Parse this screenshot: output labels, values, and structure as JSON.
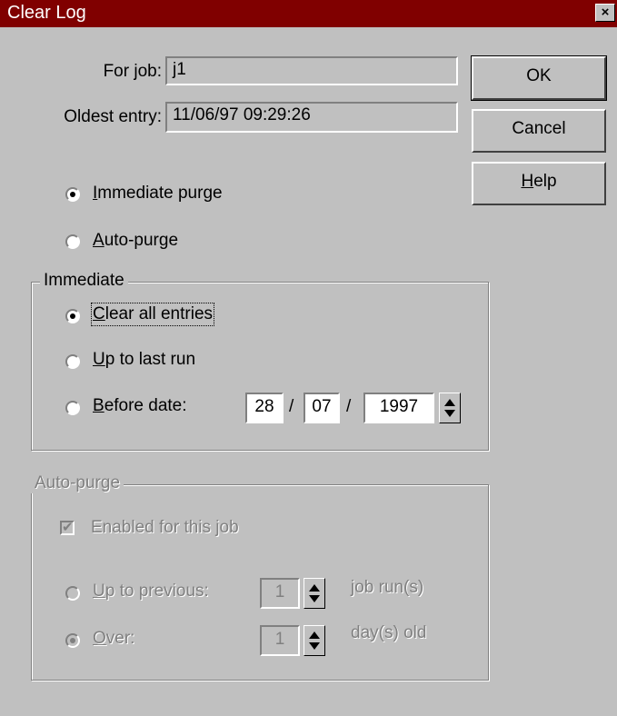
{
  "window": {
    "title": "Clear Log",
    "close_glyph": "×"
  },
  "info": {
    "for_job_label": "For job:",
    "for_job_value": "j1",
    "oldest_entry_label": "Oldest entry:",
    "oldest_entry_value": "11/06/97 09:29:26"
  },
  "buttons": {
    "ok": "OK",
    "cancel": "Cancel",
    "help_accel": "H",
    "help_rest": "elp"
  },
  "purge_mode": {
    "immediate": {
      "accel": "I",
      "rest": "mmediate purge",
      "selected": true
    },
    "auto": {
      "accel": "A",
      "rest": "uto-purge",
      "selected": false
    }
  },
  "immediate_group": {
    "legend": "Immediate",
    "clear_all": {
      "accel": "C",
      "rest": "lear all entries",
      "selected": true
    },
    "up_to_last": {
      "accel": "U",
      "rest": "p to last run",
      "selected": false
    },
    "before_date": {
      "accel": "B",
      "rest": "efore date:",
      "selected": false
    },
    "date": {
      "day": "28",
      "month": "07",
      "year": "1997",
      "separator": "/"
    }
  },
  "autopurge_group": {
    "legend": "Auto-purge",
    "enabled": {
      "label": "Enabled for this job",
      "checked": true
    },
    "up_to_previous": {
      "accel": "U",
      "rest": "p to previous:",
      "value": "1",
      "unit": "job run(s)",
      "selected": false
    },
    "over": {
      "accel": "O",
      "rest": "ver:",
      "value": "1",
      "unit": "day(s) old",
      "selected": true
    }
  },
  "colors": {
    "titlebar": "#800000",
    "face": "#c0c0c0",
    "disabled_text": "#808080"
  }
}
